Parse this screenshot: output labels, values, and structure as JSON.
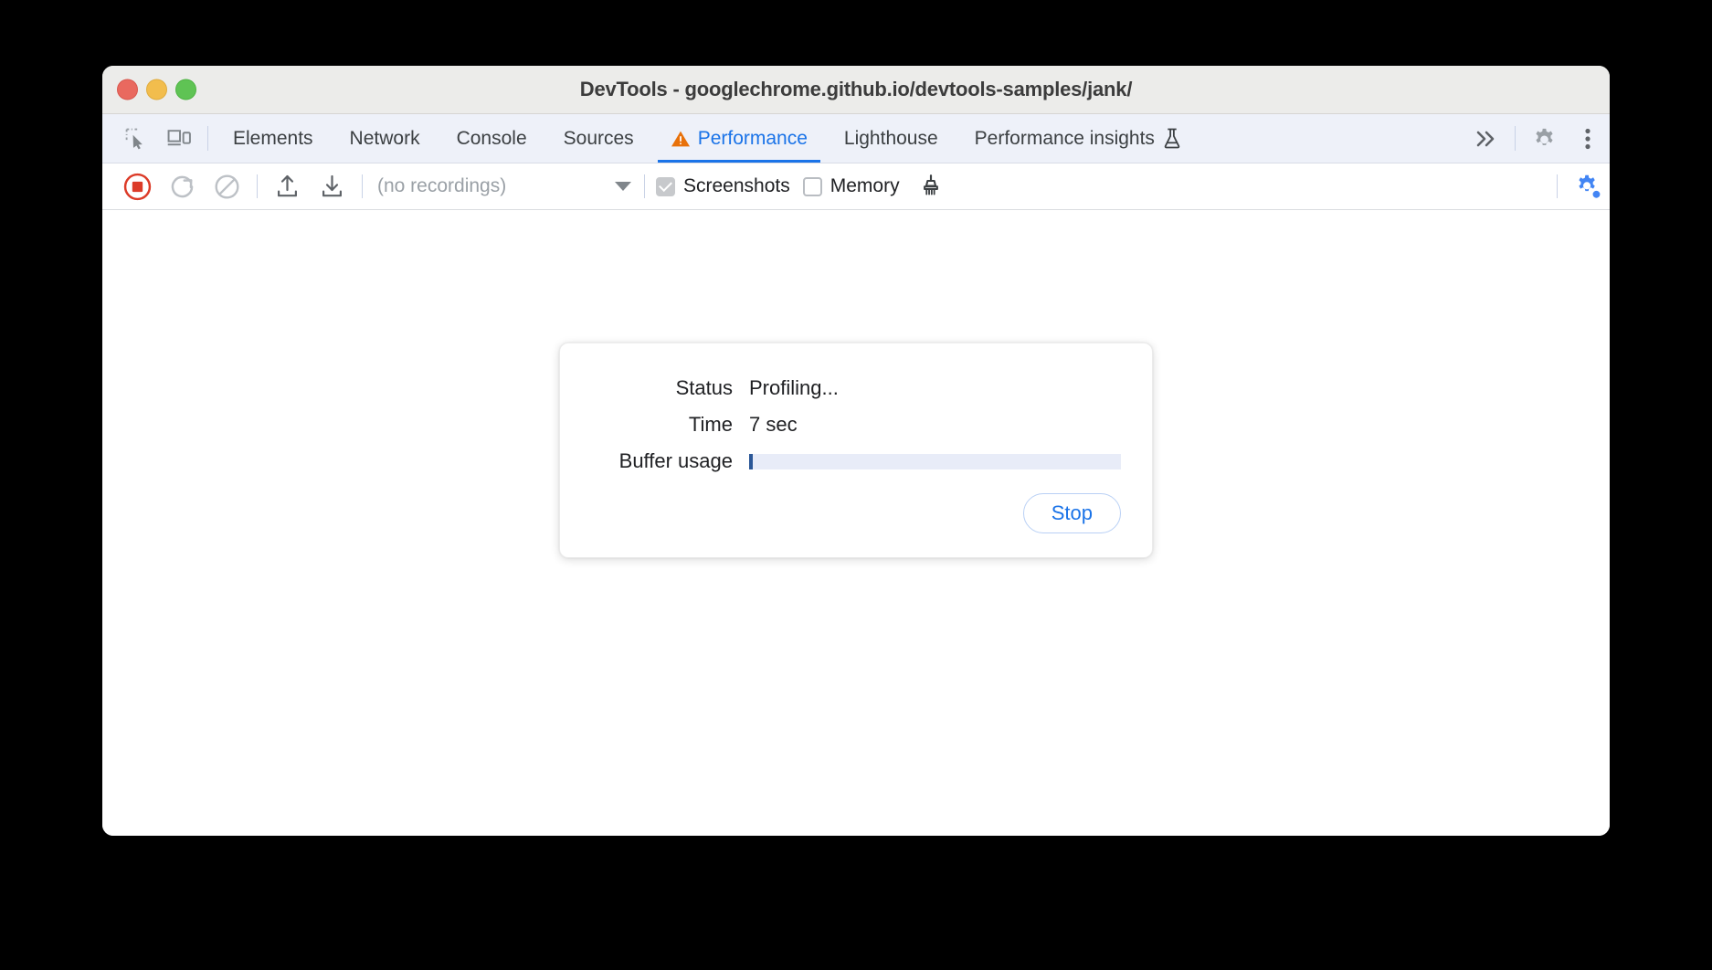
{
  "window": {
    "title": "DevTools - googlechrome.github.io/devtools-samples/jank/",
    "traffic_lights": [
      "close-button",
      "minimize-button",
      "maximize-button"
    ]
  },
  "tabbar": {
    "left_icons": [
      {
        "name": "inspect-element-icon",
        "label": "Inspect element"
      },
      {
        "name": "device-toolbar-icon",
        "label": "Toggle device toolbar"
      }
    ],
    "tabs": [
      {
        "label": "Elements",
        "active": false,
        "warning": false
      },
      {
        "label": "Network",
        "active": false,
        "warning": false
      },
      {
        "label": "Console",
        "active": false,
        "warning": false
      },
      {
        "label": "Sources",
        "active": false,
        "warning": false
      },
      {
        "label": "Performance",
        "active": true,
        "warning": true
      },
      {
        "label": "Lighthouse",
        "active": false,
        "warning": false
      },
      {
        "label": "Performance insights",
        "active": false,
        "warning": false,
        "experiment": true
      }
    ],
    "right_icons": [
      {
        "name": "more-tabs-icon",
        "label": ">>"
      },
      {
        "name": "settings-gear-icon",
        "label": "Settings"
      },
      {
        "name": "more-options-icon",
        "label": "Customize and control DevTools"
      }
    ],
    "active_color": "#1a73e8",
    "warning_color": "#e8710a"
  },
  "toolbar": {
    "record_button": {
      "name": "stop-recording-button",
      "state": "recording",
      "color": "#dc3b28"
    },
    "reload_button": {
      "name": "reload-and-record-button",
      "state": "disabled"
    },
    "clear_button": {
      "name": "clear-recording-button",
      "state": "disabled"
    },
    "upload_button": {
      "name": "load-profile-button",
      "label": "Load profile"
    },
    "download_button": {
      "name": "save-profile-button",
      "label": "Save profile"
    },
    "recordings_dropdown": {
      "value": "(no recordings)",
      "placeholder": "(no recordings)"
    },
    "screenshots_checkbox": {
      "label": "Screenshots",
      "checked": true,
      "disabled": true
    },
    "memory_checkbox": {
      "label": "Memory",
      "checked": false,
      "disabled": false
    },
    "gc_button": {
      "name": "collect-garbage-icon",
      "label": "Collect garbage"
    },
    "capture_settings_button": {
      "name": "capture-settings-gear-icon",
      "label": "Capture settings",
      "active": true,
      "color": "#4285f4"
    }
  },
  "dialog": {
    "rows": [
      {
        "label": "Status",
        "value": "Profiling..."
      },
      {
        "label": "Time",
        "value": "7 sec"
      }
    ],
    "buffer": {
      "label": "Buffer usage",
      "percent": 1,
      "fill_color": "#2b5797",
      "track_color": "#e8ecf8"
    },
    "stop_button": {
      "label": "Stop"
    }
  }
}
